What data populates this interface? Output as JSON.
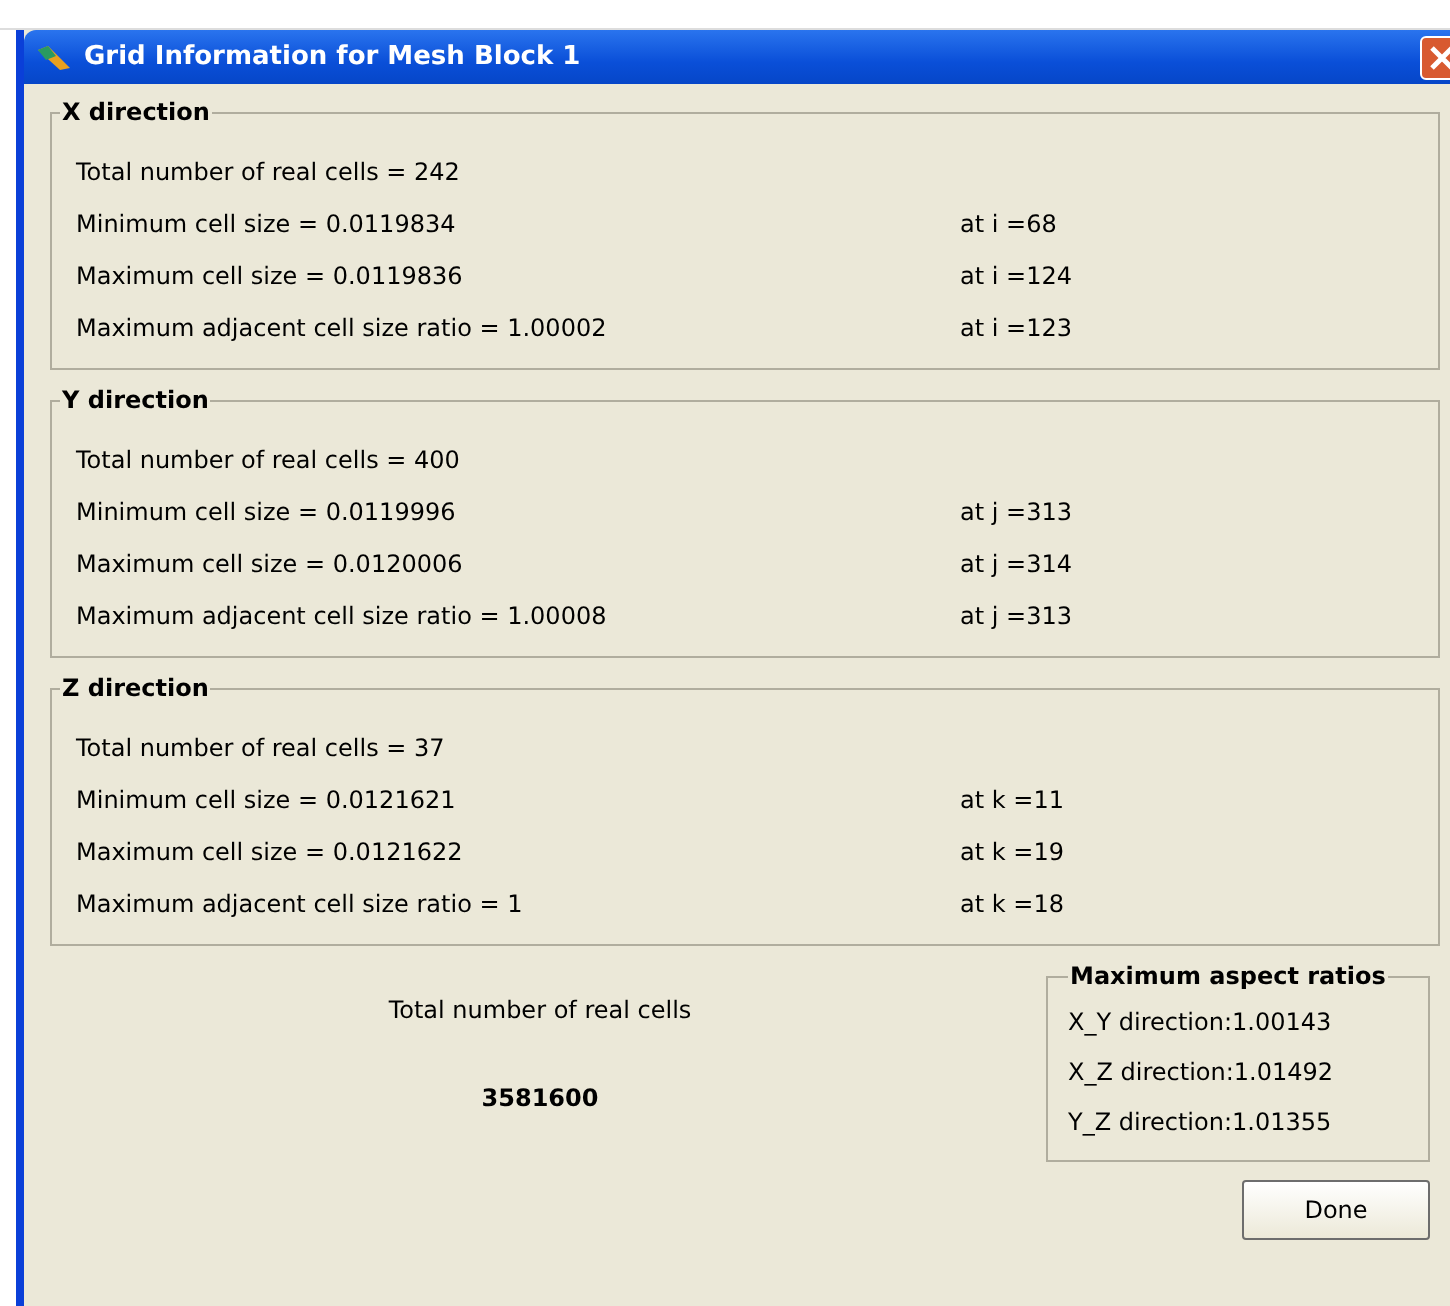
{
  "window": {
    "title": "Grid Information for Mesh Block 1"
  },
  "sections": [
    {
      "title": "X direction",
      "rows": [
        {
          "label": "Total number of real cells = 242"
        },
        {
          "label": "Minimum cell size = 0.0119834",
          "location": "at i =68"
        },
        {
          "label": "Maximum cell size = 0.0119836",
          "location": "at i =124"
        },
        {
          "label": "Maximum adjacent cell size ratio = 1.00002",
          "location": "at i =123"
        }
      ]
    },
    {
      "title": "Y direction",
      "rows": [
        {
          "label": "Total number of real cells = 400"
        },
        {
          "label": "Minimum cell size = 0.0119996",
          "location": "at j =313"
        },
        {
          "label": "Maximum cell size = 0.0120006",
          "location": "at j =314"
        },
        {
          "label": "Maximum adjacent  cell size ratio = 1.00008",
          "location": "at j =313"
        }
      ]
    },
    {
      "title": "Z direction",
      "rows": [
        {
          "label": "Total number of real cells = 37"
        },
        {
          "label": "Minimum cell size = 0.0121621",
          "location": "at k =11"
        },
        {
          "label": "Maximum cell size = 0.0121622",
          "location": "at k =19"
        },
        {
          "label": "Maximum adjacent cell size ratio = 1",
          "location": "at k =18"
        }
      ]
    }
  ],
  "total": {
    "label": "Total number of real cells",
    "value": "3581600"
  },
  "aspect_ratios": {
    "title": "Maximum aspect ratios",
    "items": [
      "X_Y direction:1.00143",
      "X_Z direction:1.01492",
      "Y_Z direction:1.01355"
    ]
  },
  "buttons": [
    "Done"
  ]
}
